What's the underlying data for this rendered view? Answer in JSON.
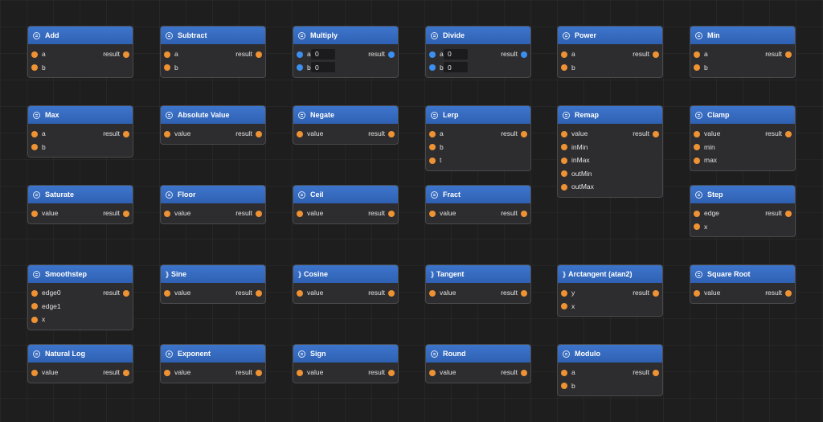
{
  "colors": {
    "background": "#1e1e1e",
    "node_body": "#2d2d2f",
    "node_header": "#3569c0",
    "port_float": "#ee9234",
    "port_vector": "#3c8ff0"
  },
  "nodes": [
    {
      "id": "add",
      "title": "Add",
      "icon": "math-icon",
      "inputs": [
        {
          "label": "a"
        },
        {
          "label": "b"
        }
      ],
      "output": "result"
    },
    {
      "id": "subtract",
      "title": "Subtract",
      "icon": "math-icon",
      "inputs": [
        {
          "label": "a"
        },
        {
          "label": "b"
        }
      ],
      "output": "result"
    },
    {
      "id": "multiply",
      "title": "Multiply",
      "icon": "math-icon",
      "port_color": "blue",
      "inputs": [
        {
          "label": "a",
          "value": "0"
        },
        {
          "label": "b",
          "value": "0"
        }
      ],
      "output": "result"
    },
    {
      "id": "divide",
      "title": "Divide",
      "icon": "math-icon",
      "port_color": "blue",
      "inputs": [
        {
          "label": "a",
          "value": "0"
        },
        {
          "label": "b",
          "value": "0"
        }
      ],
      "output": "result"
    },
    {
      "id": "power",
      "title": "Power",
      "icon": "math-icon",
      "inputs": [
        {
          "label": "a"
        },
        {
          "label": "b"
        }
      ],
      "output": "result"
    },
    {
      "id": "min",
      "title": "Min",
      "icon": "math-icon",
      "inputs": [
        {
          "label": "a"
        },
        {
          "label": "b"
        }
      ],
      "output": "result"
    },
    {
      "id": "max",
      "title": "Max",
      "icon": "math-icon",
      "inputs": [
        {
          "label": "a"
        },
        {
          "label": "b"
        }
      ],
      "output": "result"
    },
    {
      "id": "absolute-value",
      "title": "Absolute Value",
      "icon": "math-icon",
      "inputs": [
        {
          "label": "value"
        }
      ],
      "output": "result"
    },
    {
      "id": "negate",
      "title": "Negate",
      "icon": "math-icon",
      "inputs": [
        {
          "label": "value"
        }
      ],
      "output": "result"
    },
    {
      "id": "lerp",
      "title": "Lerp",
      "icon": "math-icon",
      "inputs": [
        {
          "label": "a"
        },
        {
          "label": "b"
        },
        {
          "label": "t"
        }
      ],
      "output": "result"
    },
    {
      "id": "remap",
      "title": "Remap",
      "icon": "math-icon",
      "inputs": [
        {
          "label": "value"
        },
        {
          "label": "inMin"
        },
        {
          "label": "inMax"
        },
        {
          "label": "outMin"
        },
        {
          "label": "outMax"
        }
      ],
      "output": "result"
    },
    {
      "id": "clamp",
      "title": "Clamp",
      "icon": "math-icon",
      "inputs": [
        {
          "label": "value"
        },
        {
          "label": "min"
        },
        {
          "label": "max"
        }
      ],
      "output": "result"
    },
    {
      "id": "saturate",
      "title": "Saturate",
      "icon": "math-icon",
      "inputs": [
        {
          "label": "value"
        }
      ],
      "output": "result"
    },
    {
      "id": "floor",
      "title": "Floor",
      "icon": "math-icon",
      "inputs": [
        {
          "label": "value"
        }
      ],
      "output": "result"
    },
    {
      "id": "ceil",
      "title": "Ceil",
      "icon": "math-icon",
      "inputs": [
        {
          "label": "value"
        }
      ],
      "output": "result"
    },
    {
      "id": "fract",
      "title": "Fract",
      "icon": "math-icon",
      "inputs": [
        {
          "label": "value"
        }
      ],
      "output": "result"
    },
    {
      "id": "step",
      "title": "Step",
      "icon": "math-icon",
      "inputs": [
        {
          "label": "edge"
        },
        {
          "label": "x"
        }
      ],
      "output": "result"
    },
    {
      "id": "smoothstep",
      "title": "Smoothstep",
      "icon": "math-icon",
      "inputs": [
        {
          "label": "edge0"
        },
        {
          "label": "edge1"
        },
        {
          "label": "x"
        }
      ],
      "output": "result"
    },
    {
      "id": "sine",
      "title": "Sine",
      "icon": "wave-icon",
      "inputs": [
        {
          "label": "value"
        }
      ],
      "output": "result"
    },
    {
      "id": "cosine",
      "title": "Cosine",
      "icon": "wave-icon",
      "inputs": [
        {
          "label": "value"
        }
      ],
      "output": "result"
    },
    {
      "id": "tangent",
      "title": "Tangent",
      "icon": "wave-icon",
      "inputs": [
        {
          "label": "value"
        }
      ],
      "output": "result"
    },
    {
      "id": "arctangent",
      "title": "Arctangent (atan2)",
      "icon": "wave-icon",
      "inputs": [
        {
          "label": "y"
        },
        {
          "label": "x"
        }
      ],
      "output": "result"
    },
    {
      "id": "square-root",
      "title": "Square Root",
      "icon": "math-icon",
      "inputs": [
        {
          "label": "value"
        }
      ],
      "output": "result"
    },
    {
      "id": "natural-log",
      "title": "Natural Log",
      "icon": "math-icon",
      "inputs": [
        {
          "label": "value"
        }
      ],
      "output": "result"
    },
    {
      "id": "exponent",
      "title": "Exponent",
      "icon": "math-icon",
      "inputs": [
        {
          "label": "value"
        }
      ],
      "output": "result"
    },
    {
      "id": "sign",
      "title": "Sign",
      "icon": "math-icon",
      "inputs": [
        {
          "label": "value"
        }
      ],
      "output": "result"
    },
    {
      "id": "round",
      "title": "Round",
      "icon": "math-icon",
      "inputs": [
        {
          "label": "value"
        }
      ],
      "output": "result"
    },
    {
      "id": "modulo",
      "title": "Modulo",
      "icon": "math-icon",
      "inputs": [
        {
          "label": "a"
        },
        {
          "label": "b"
        }
      ],
      "output": "result"
    }
  ]
}
